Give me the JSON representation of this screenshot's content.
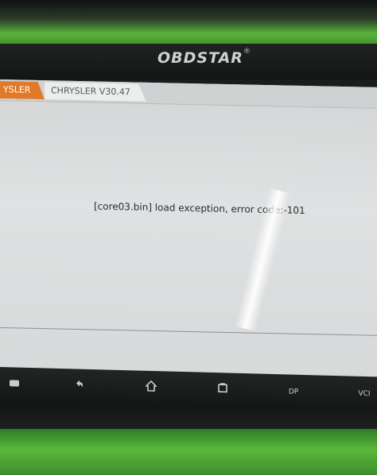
{
  "brand": {
    "logo_text": "OBDSTAR",
    "reg_mark": "®"
  },
  "tabs": [
    {
      "label": "YSLER",
      "active": true,
      "color": "#e07a2a"
    },
    {
      "label": "CHRYSLER V30.47",
      "active": false
    }
  ],
  "message": {
    "text": "[core03.bin] load exception, error code:-101"
  },
  "navbar": {
    "items": [
      {
        "icon": "window-icon"
      },
      {
        "icon": "back-arrow-icon"
      },
      {
        "icon": "home-icon"
      },
      {
        "icon": "recent-apps-icon"
      },
      {
        "label": "DP"
      },
      {
        "label": "VCI"
      }
    ]
  },
  "colors": {
    "bezel_green": "#59b23a",
    "tab_orange": "#e07a2a",
    "screen": "#dfe1e2"
  }
}
